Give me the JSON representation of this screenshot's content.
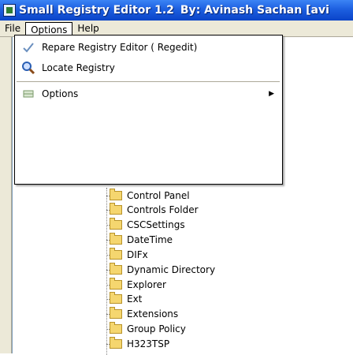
{
  "window": {
    "title_app": "Small Registry Editor 1.2",
    "title_author": "By: Avinash Sachan [avi"
  },
  "menubar": {
    "items": [
      {
        "label": "File"
      },
      {
        "label": "Options"
      },
      {
        "label": "Help"
      }
    ]
  },
  "options_menu": {
    "items": [
      {
        "label": "Repare Registry Editor ( Regedit)",
        "icon": "check-icon"
      },
      {
        "label": "Locate Registry",
        "icon": "magnifier-icon"
      },
      {
        "label": "Options",
        "icon": "options-icon",
        "submenu": true
      }
    ],
    "submenu_arrow": "▶"
  },
  "tree": {
    "items": [
      "Control Panel",
      "Controls Folder",
      "CSCSettings",
      "DateTime",
      "DIFx",
      "Dynamic Directory",
      "Explorer",
      "Ext",
      "Extensions",
      "Group Policy",
      "H323TSP"
    ]
  }
}
